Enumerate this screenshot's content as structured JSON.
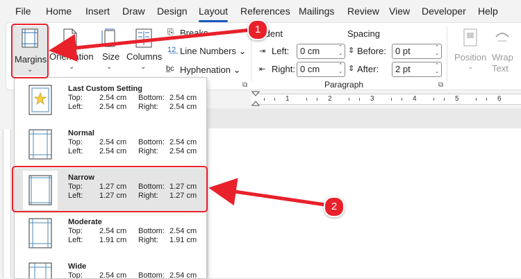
{
  "menu": {
    "tabs": [
      "File",
      "Home",
      "Insert",
      "Draw",
      "Design",
      "Layout",
      "References",
      "Mailings",
      "Review",
      "View",
      "Developer",
      "Help"
    ],
    "active": "Layout"
  },
  "ribbon": {
    "margins_label": "Margins",
    "orientation_label": "Orientation",
    "size_label": "Size",
    "columns_label": "Columns",
    "breaks_label": "Breaks",
    "line_numbers_label": "Line Numbers",
    "hyphenation_label": "Hyphenation",
    "indent_label": "Indent",
    "spacing_label": "Spacing",
    "left_label": "Left:",
    "right_label": "Right:",
    "before_label": "Before:",
    "after_label": "After:",
    "left_value": "0 cm",
    "right_value": "0 cm",
    "before_value": "0 pt",
    "after_value": "2 pt",
    "paragraph_group": "Paragraph",
    "position_label": "Position",
    "wrap_text_line1": "Wrap",
    "wrap_text_line2": "Text"
  },
  "margins_menu": {
    "options": [
      {
        "name": "Last Custom Setting",
        "top": "2.54 cm",
        "bottom": "2.54 cm",
        "left": "2.54 cm",
        "right": "2.54 cm"
      },
      {
        "name": "Normal",
        "top": "2.54 cm",
        "bottom": "2.54 cm",
        "left": "2.54 cm",
        "right": "2.54 cm"
      },
      {
        "name": "Narrow",
        "top": "1.27 cm",
        "bottom": "1.27 cm",
        "left": "1.27 cm",
        "right": "1.27 cm"
      },
      {
        "name": "Moderate",
        "top": "2.54 cm",
        "bottom": "2.54 cm",
        "left": "1.91 cm",
        "right": "1.91 cm"
      },
      {
        "name": "Wide",
        "top": "2.54 cm",
        "bottom": "2.54 cm",
        "left": "",
        "right": ""
      }
    ],
    "labels": {
      "top": "Top:",
      "bottom": "Bottom:",
      "left": "Left:",
      "right": "Right:"
    },
    "selected": "Narrow"
  },
  "annotations": {
    "step1": "1",
    "step2": "2",
    "color": "#e8212b"
  },
  "ruler": {
    "numbers": [
      "1",
      "2",
      "3",
      "4",
      "5",
      "6"
    ]
  }
}
